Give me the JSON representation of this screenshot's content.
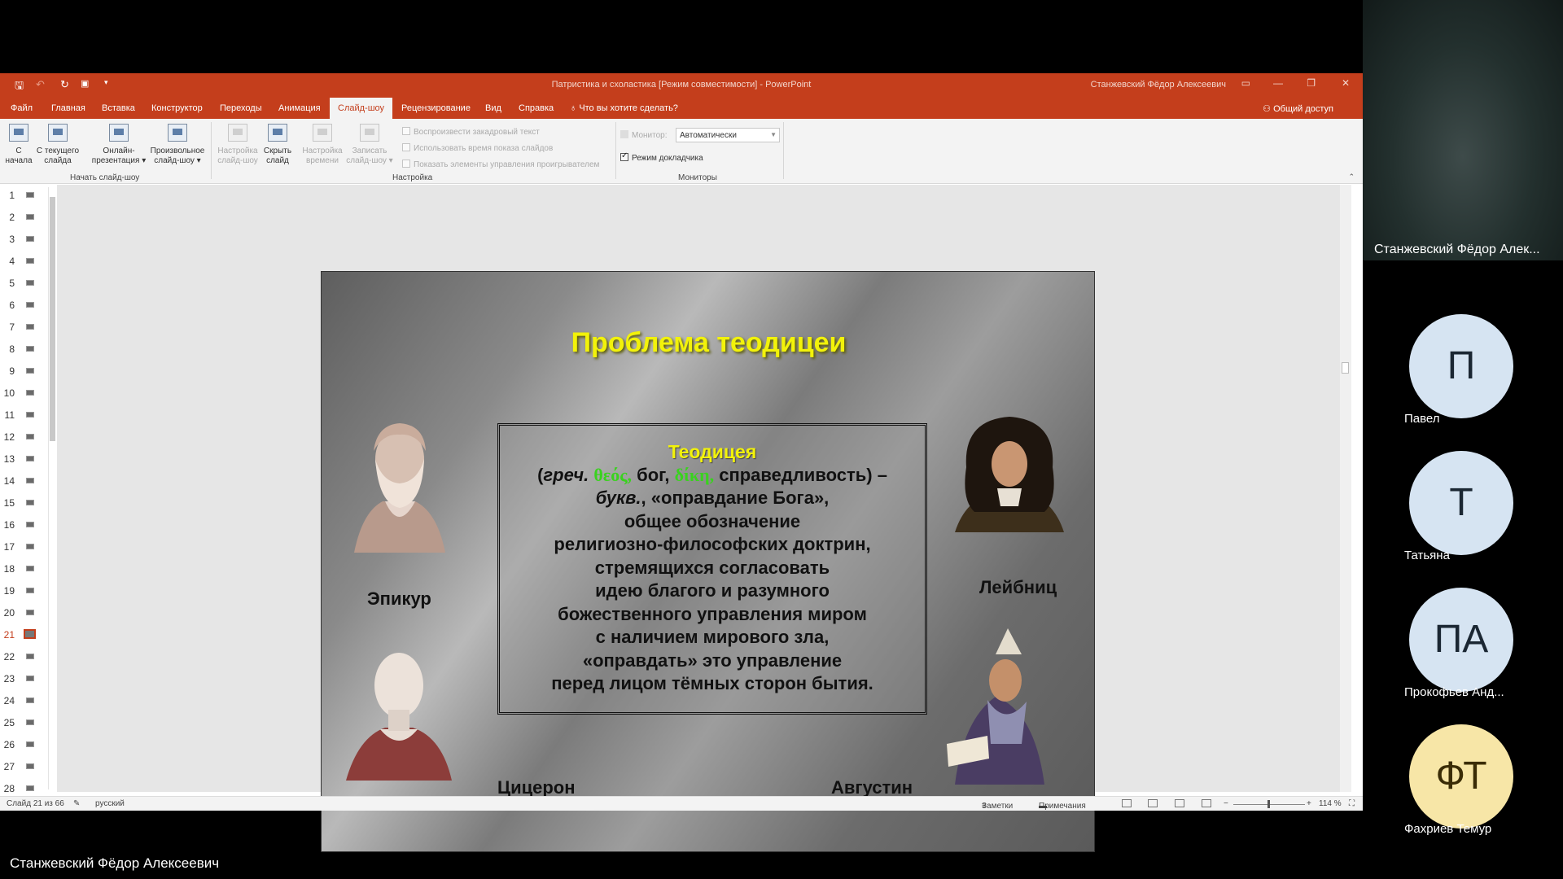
{
  "app": {
    "title": "Патристика и схоластика [Режим совместимости] - PowerPoint",
    "user": "Станжевский Фёдор Алексеевич"
  },
  "ribbon_tabs": [
    "Файл",
    "Главная",
    "Вставка",
    "Конструктор",
    "Переходы",
    "Анимация",
    "Слайд-шоу",
    "Рецензирование",
    "Вид",
    "Справка"
  ],
  "active_tab": "Слайд-шоу",
  "tell_me": "Что вы хотите сделать?",
  "share": "Общий доступ",
  "ribbon": {
    "start_group": {
      "label": "Начать слайд-шоу",
      "buttons": [
        {
          "line1": "С",
          "line2": "начала"
        },
        {
          "line1": "С текущего",
          "line2": "слайда"
        },
        {
          "line1": "Онлайн-",
          "line2": "презентация ▾"
        },
        {
          "line1": "Произвольное",
          "line2": "слайд-шоу ▾"
        }
      ]
    },
    "setup_group": {
      "label": "Настройка",
      "buttons": [
        {
          "line1": "Настройка",
          "line2": "слайд-шоу"
        },
        {
          "line1": "Скрыть",
          "line2": "слайд"
        },
        {
          "line1": "Настройка",
          "line2": "времени"
        },
        {
          "line1": "Записать",
          "line2": "слайд-шоу ▾"
        }
      ],
      "checks": [
        "Воспроизвести закадровый текст",
        "Использовать время показа слайдов",
        "Показать элементы управления проигрывателем"
      ]
    },
    "monitors_group": {
      "label": "Мониторы",
      "monitor_label": "Монитор:",
      "monitor_value": "Автоматически",
      "presenter_view": "Режим докладчика"
    }
  },
  "slide_numbers": [
    "1",
    "2",
    "3",
    "4",
    "5",
    "6",
    "7",
    "8",
    "9",
    "10",
    "11",
    "12",
    "13",
    "14",
    "15",
    "16",
    "17",
    "18",
    "19",
    "20",
    "21",
    "22",
    "23",
    "24",
    "25",
    "26",
    "27",
    "28"
  ],
  "active_slide": "21",
  "slide": {
    "title": "Проблема теодицеи",
    "term": "Теодицея",
    "def_line1_pre": "(",
    "def_line1_greech": "греч.",
    "def_line1_greek1": "θεός,",
    "def_line1_mid": "бог,",
    "def_line1_greek2": "δίκη,",
    "def_line1_end": "справедливость) –",
    "def_line2_buk": "букв.",
    "def_line2_rest": ", «оправдание Бога»,",
    "def_lines": [
      "общее обозначение",
      "религиозно-философских доктрин,",
      "стремящихся согласовать",
      "идею благого и разумного",
      "божественного управления миром",
      "с наличием мирового зла,",
      "«оправдать» это управление",
      "перед лицом тёмных сторон бытия."
    ],
    "names": {
      "epicurus": "Эпикур",
      "leibniz": "Лейбниц",
      "cicero": "Цицерон",
      "augustine": "Августин"
    }
  },
  "status": {
    "slide_count": "Слайд 21 из 66",
    "language": "русский",
    "notes": "Заметки",
    "comments": "Примечания",
    "zoom": "114 %"
  },
  "participants": {
    "video_name": "Станжевский Фёдор Алек...",
    "list": [
      {
        "initials": "П",
        "name": "Павел"
      },
      {
        "initials": "Т",
        "name": "Татьяна"
      },
      {
        "initials": "ПА",
        "name": "Прокофьев Анд..."
      },
      {
        "initials": "ФТ",
        "name": "Фахриев Темур"
      }
    ]
  },
  "presenter_label": "Станжевский Фёдор Алексеевич",
  "colors": {
    "ppt_accent": "#c43e1c",
    "slide_title": "#f2f20a",
    "greek": "#39d21e",
    "avatar": "#d6e4f2",
    "avatar_alt": "#f7e6a7"
  },
  "icons": [
    "save-icon",
    "undo-icon",
    "redo-icon",
    "start-from-beginning-icon",
    "lightbulb-icon",
    "person-icon",
    "notes-icon",
    "comments-icon"
  ]
}
